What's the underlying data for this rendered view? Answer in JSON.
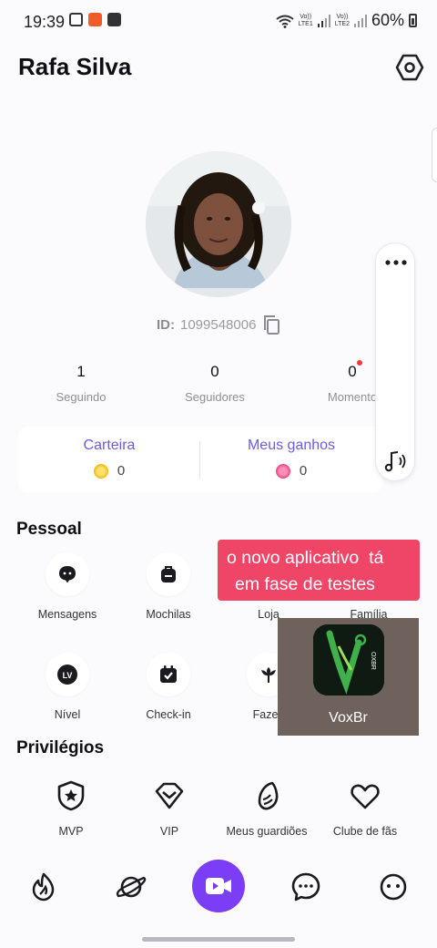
{
  "status_bar": {
    "time": "19:39",
    "battery": "60%",
    "lte1": "LTE1",
    "lte2": "LTE2",
    "vo": "Vo))"
  },
  "header": {
    "title": "Rafa Silva"
  },
  "profile": {
    "id_label": "ID:",
    "id_value": "1099548006"
  },
  "stats": [
    {
      "value": "1",
      "label": "Seguindo"
    },
    {
      "value": "0",
      "label": "Seguidores"
    },
    {
      "value": "0",
      "label": "Momento"
    }
  ],
  "wallet": {
    "carteira_label": "Carteira",
    "carteira_value": "0",
    "ganhos_label": "Meus ganhos",
    "ganhos_value": "0"
  },
  "sections": {
    "pessoal": "Pessoal",
    "privilegios": "Privilégios"
  },
  "pessoal_items": [
    {
      "label": "Mensagens",
      "icon": "message-bubble-icon"
    },
    {
      "label": "Mochilas",
      "icon": "backpack-icon"
    },
    {
      "label": "Loja",
      "icon": "shop-icon"
    },
    {
      "label": "Família",
      "icon": "family-icon"
    },
    {
      "label": "Nível",
      "icon": "level-badge-icon",
      "badge": "LV"
    },
    {
      "label": "Check-in",
      "icon": "calendar-check-icon"
    },
    {
      "label": "Fazen",
      "icon": "flower-icon"
    }
  ],
  "privilegios_items": [
    {
      "label": "MVP",
      "icon": "shield-star-icon"
    },
    {
      "label": "VIP",
      "icon": "diamond-icon"
    },
    {
      "label": "Meus guardiões",
      "icon": "wing-icon"
    },
    {
      "label": "Clube de fãs",
      "icon": "heart-icon"
    }
  ],
  "overlay": {
    "banner_line1": "o novo aplicativo  tá",
    "banner_line2": "em fase de testes",
    "video_caption": "VoxBr",
    "logo_text": "OXBR"
  },
  "bottom_nav": [
    {
      "name": "nav-home",
      "icon": "flame-icon"
    },
    {
      "name": "nav-explore",
      "icon": "planet-icon"
    },
    {
      "name": "nav-live",
      "icon": "video-camera-icon"
    },
    {
      "name": "nav-messages",
      "icon": "chat-bubble-icon"
    },
    {
      "name": "nav-profile",
      "icon": "profile-face-icon"
    }
  ],
  "colors": {
    "accent": "#7b3df5",
    "wallet_label": "#6c5be0",
    "banner": "#ef4566",
    "notification": "#f23b3b"
  }
}
